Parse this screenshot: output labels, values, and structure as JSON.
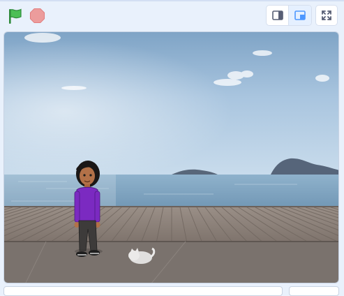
{
  "toolbar": {
    "green_flag_icon": "green-flag-icon",
    "stop_icon": "stop-sign-icon",
    "small_stage_icon": "small-stage-icon",
    "normal_stage_icon": "normal-stage-icon",
    "fullscreen_icon": "fullscreen-icon",
    "colors": {
      "flag": "#4cbf56",
      "stop": "#ec9c9c",
      "active_mode": "#4c97ff"
    }
  },
  "stage": {
    "backdrop": "beach-boardwalk",
    "sprites": [
      {
        "name": "girl-character"
      },
      {
        "name": "cat-sprite"
      }
    ]
  }
}
